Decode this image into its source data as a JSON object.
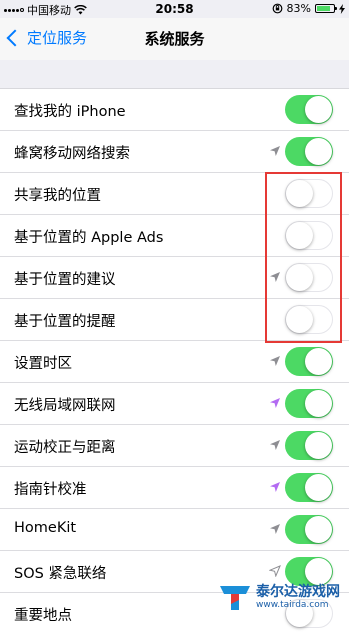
{
  "status_bar": {
    "carrier": "中国移动",
    "time": "20:58",
    "battery": "83%"
  },
  "nav": {
    "back_label": "定位服务",
    "title": "系统服务"
  },
  "rows": [
    {
      "label": "查找我的 iPhone",
      "on": true,
      "arrow": ""
    },
    {
      "label": "蜂窝移动网络搜索",
      "on": true,
      "arrow": "gray"
    },
    {
      "label": "共享我的位置",
      "on": false,
      "arrow": ""
    },
    {
      "label": "基于位置的 Apple Ads",
      "on": false,
      "arrow": ""
    },
    {
      "label": "基于位置的建议",
      "on": false,
      "arrow": "gray"
    },
    {
      "label": "基于位置的提醒",
      "on": false,
      "arrow": ""
    },
    {
      "label": "设置时区",
      "on": true,
      "arrow": "gray"
    },
    {
      "label": "无线局域网联网",
      "on": true,
      "arrow": "purple"
    },
    {
      "label": "运动校正与距离",
      "on": true,
      "arrow": "gray"
    },
    {
      "label": "指南针校准",
      "on": true,
      "arrow": "purple"
    },
    {
      "label": "HomeKit",
      "on": true,
      "arrow": "gray"
    },
    {
      "label": "SOS 紧急联络",
      "on": true,
      "arrow": "hollow"
    },
    {
      "label": "重要地点",
      "on": false,
      "arrow": ""
    }
  ],
  "colors": {
    "accent": "#007aff",
    "toggle_on": "#4cd964",
    "highlight": "#e53935",
    "arrow_gray": "#8e8e93",
    "arrow_purple": "#b36bf2"
  },
  "watermark": {
    "title": "泰尔达游戏网",
    "url": "www.tairda.com"
  }
}
